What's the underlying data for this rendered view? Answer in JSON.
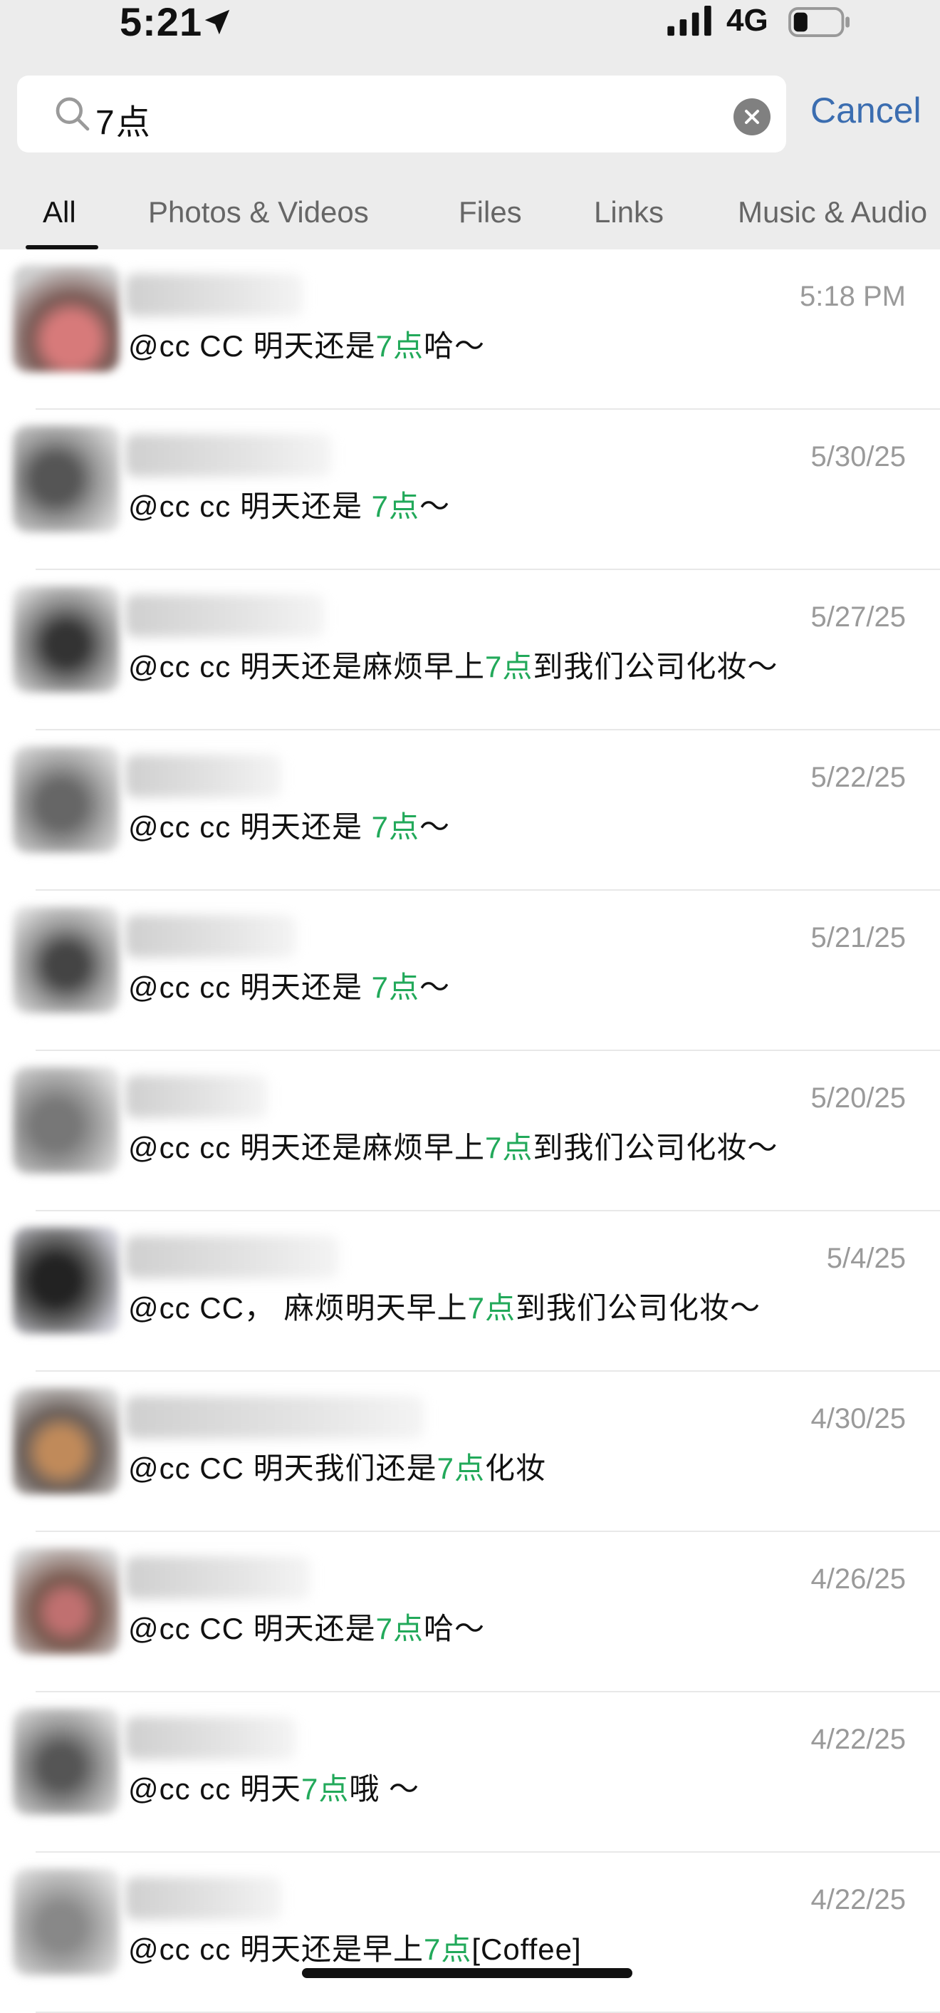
{
  "status": {
    "time": "5:21",
    "network": "4G"
  },
  "search": {
    "query": "7点",
    "cancel_label": "Cancel"
  },
  "tabs": [
    {
      "label": "All",
      "active": true
    },
    {
      "label": "Photos & Videos"
    },
    {
      "label": "Files"
    },
    {
      "label": "Links"
    },
    {
      "label": "Music & Audio"
    }
  ],
  "results": [
    {
      "date": "5:18 PM",
      "pre": "@cc CC  明天还是",
      "hl": "7点",
      "post": "哈～"
    },
    {
      "date": "5/30/25",
      "pre": "@cc   cc 明天还是 ",
      "hl": "7点",
      "post": "～"
    },
    {
      "date": "5/27/25",
      "pre": "@cc   cc 明天还是麻烦早上",
      "hl": "7点",
      "post": "到我们公司化妆～"
    },
    {
      "date": "5/22/25",
      "pre": "@cc   cc  明天还是 ",
      "hl": "7点",
      "post": "～"
    },
    {
      "date": "5/21/25",
      "pre": "@cc   cc 明天还是 ",
      "hl": "7点",
      "post": "～"
    },
    {
      "date": "5/20/25",
      "pre": "@cc   cc 明天还是麻烦早上",
      "hl": "7点",
      "post": "到我们公司化妆～"
    },
    {
      "date": "5/4/25",
      "pre": "@cc CC，  麻烦明天早上",
      "hl": "7点",
      "post": "到我们公司化妆～"
    },
    {
      "date": "4/30/25",
      "pre": "@cc CC 明天我们还是",
      "hl": "7点",
      "post": "化妆"
    },
    {
      "date": "4/26/25",
      "pre": "@cc CC 明天还是",
      "hl": "7点",
      "post": "哈～"
    },
    {
      "date": "4/22/25",
      "pre": "@cc   cc 明天",
      "hl": "7点",
      "post": "哦 ～"
    },
    {
      "date": "4/22/25",
      "pre": "@cc   cc  明天还是早上",
      "hl": "7点",
      "post": "[Coffee]"
    }
  ],
  "colors": {
    "highlight": "#22a95a",
    "link": "#3b6db0",
    "date": "#9a9a9a"
  }
}
